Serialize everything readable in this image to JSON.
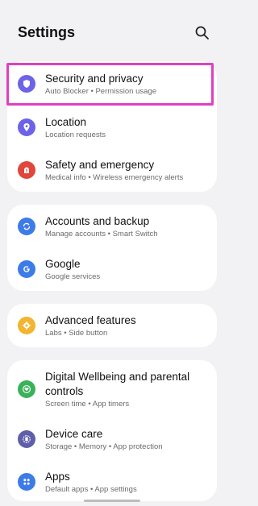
{
  "header": {
    "title": "Settings",
    "search_icon": "search-icon"
  },
  "colors": {
    "highlight": "#e040c0",
    "security": "#6c63e8",
    "location": "#6c63e8",
    "safety": "#e0463c",
    "accounts": "#3d7be8",
    "google": "#3d7be8",
    "advanced": "#f2b431",
    "wellbeing": "#3bb15a",
    "device_care": "#5f5ea8",
    "apps": "#3d7be8"
  },
  "groups": [
    {
      "items": [
        {
          "label": "Security and privacy",
          "sub": "Auto Blocker  •  Permission usage",
          "icon": "shield-icon"
        },
        {
          "label": "Location",
          "sub": "Location requests",
          "icon": "location-pin-icon"
        },
        {
          "label": "Safety and emergency",
          "sub": "Medical info  •  Wireless emergency alerts",
          "icon": "alert-icon"
        }
      ]
    },
    {
      "items": [
        {
          "label": "Accounts and backup",
          "sub": "Manage accounts  •  Smart Switch",
          "icon": "sync-icon"
        },
        {
          "label": "Google",
          "sub": "Google services",
          "icon": "google-icon"
        }
      ]
    },
    {
      "items": [
        {
          "label": "Advanced features",
          "sub": "Labs  •  Side button",
          "icon": "gear-plus-icon"
        }
      ]
    },
    {
      "items": [
        {
          "label": "Digital Wellbeing and parental",
          "label2": "controls",
          "sub": "Screen time  •  App timers",
          "icon": "heart-circle-icon"
        },
        {
          "label": "Device care",
          "sub": "Storage  •  Memory  •  App protection",
          "icon": "device-care-icon"
        },
        {
          "label": "Apps",
          "sub": "Default apps  •  App settings",
          "icon": "apps-grid-icon"
        }
      ]
    }
  ]
}
